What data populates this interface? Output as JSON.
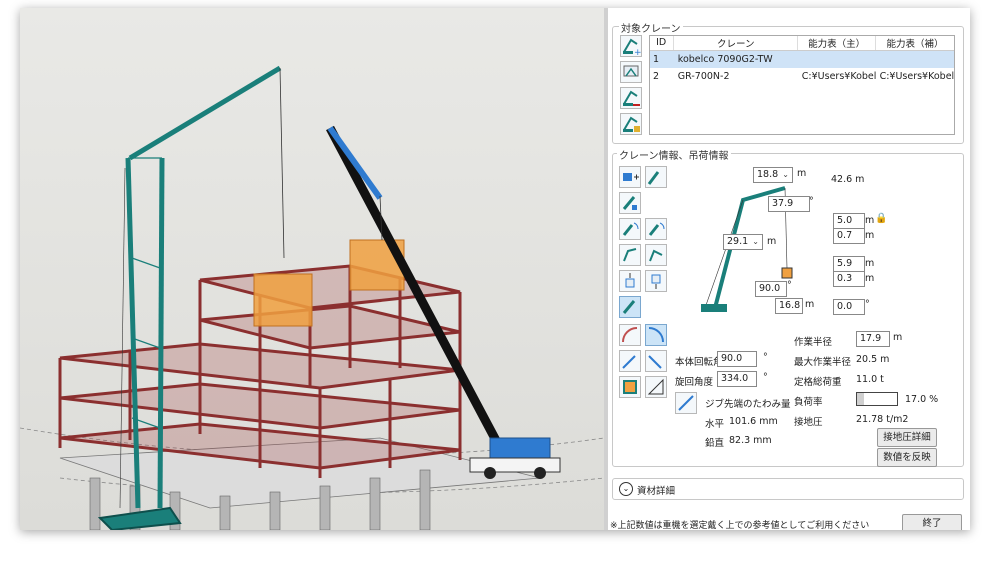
{
  "crane_list": {
    "legend": "対象クレーン",
    "columns": [
      "ID",
      "クレーン",
      "能力表（主）",
      "能力表（補）"
    ],
    "rows": [
      {
        "id": "1",
        "crane": "kobelco 7090G2-TW",
        "main": "",
        "aux": ""
      },
      {
        "id": "2",
        "crane": "GR-700N-2",
        "main": "C:¥Users¥Kobel",
        "aux": "C:¥Users¥Kobel"
      }
    ],
    "selected_row": 1
  },
  "crane_info": {
    "legend": "クレーン情報、吊荷情報",
    "diagram": {
      "jib_length": "18.8",
      "jib_length_unit": "m",
      "total_height": "42.6 m",
      "jib_offset": "37.9",
      "jib_offset_unit": "°",
      "boom_length": "29.1",
      "boom_length_unit": "m",
      "hook_height_1": "5.0",
      "hook_height_2": "0.7",
      "load_height_1": "5.9",
      "load_height_2": "0.3",
      "boom_angle": "90.0",
      "boom_angle_unit": "°",
      "base_distance": "16.8",
      "base_distance_unit": "m",
      "tilt": "0.0",
      "tilt_unit": "°",
      "unit_m": "m"
    },
    "rotation": {
      "body_label": "本体回転角",
      "body_value": "90.0",
      "body_unit": "°",
      "slew_label": "旋回角度",
      "slew_value": "334.0",
      "slew_unit": "°"
    },
    "deflection": {
      "label": "ジブ先端のたわみ量",
      "horizontal_label": "水平",
      "horizontal_value": "101.6 mm",
      "vertical_label": "鉛直",
      "vertical_value": "82.3 mm"
    },
    "results": {
      "radius_label": "作業半径",
      "radius_value": "17.9",
      "radius_unit": "m",
      "max_radius_label": "最大作業半径",
      "max_radius_value": "20.5 m",
      "rated_load_label": "定格総荷重",
      "rated_load_value": "11.0 t",
      "load_ratio_label": "負荷率",
      "load_ratio_value": "17.0 %",
      "load_ratio": 0.17,
      "ground_pressure_label": "接地圧",
      "ground_pressure_value": "21.78 t/m2"
    },
    "buttons": {
      "ground_detail": "接地圧詳細",
      "apply_values": "数値を反映"
    }
  },
  "material_detail": {
    "chevron": "⌄",
    "label": "資材詳細"
  },
  "footer": {
    "note": "※上記数値は重機を選定戴く上での参考値としてご利用ください",
    "close_button": "終了"
  },
  "colors": {
    "crane_green": "#1a7f7a",
    "crane_blue": "#2f7bd0",
    "steel": "#a23b3b",
    "load": "#f0a040",
    "selection": "#cfe3f7"
  }
}
